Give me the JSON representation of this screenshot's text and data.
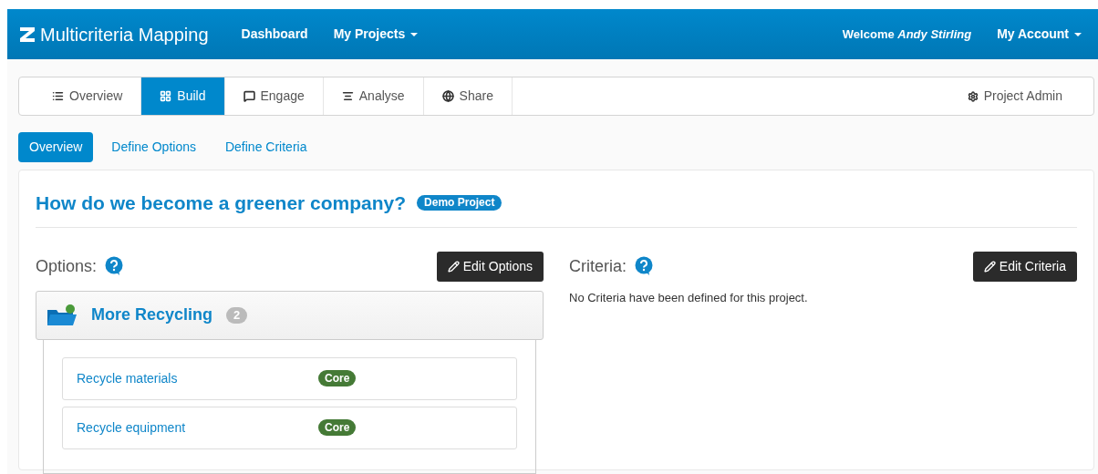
{
  "navbar": {
    "brand": "Multicriteria Mapping",
    "links": [
      {
        "label": "Dashboard",
        "dropdown": false
      },
      {
        "label": "My Projects",
        "dropdown": true
      }
    ],
    "welcome": "Welcome *Andy Stirling*",
    "account": {
      "label": "My Account",
      "dropdown": true
    }
  },
  "tabs": [
    {
      "label": "Overview",
      "selected": false
    },
    {
      "label": "Build",
      "selected": true
    },
    {
      "label": "Engage",
      "selected": false
    },
    {
      "label": "Analyse",
      "selected": false
    },
    {
      "label": "Share",
      "selected": false
    }
  ],
  "admin_link": "Project Admin",
  "subtabs": [
    {
      "label": "Overview",
      "selected": true
    },
    {
      "label": "Define Options",
      "selected": false
    },
    {
      "label": "Define Criteria",
      "selected": false
    }
  ],
  "project": {
    "title": "How do we become a greener company?",
    "badge": "Demo Project"
  },
  "options": {
    "heading": "Options:",
    "button": "Edit Options",
    "group": {
      "title": "More Recycling",
      "count": "2",
      "items": [
        {
          "name": "Recycle materials",
          "tag": "Core"
        },
        {
          "name": "Recycle equipment",
          "tag": "Core"
        }
      ]
    }
  },
  "criteria": {
    "heading": "Criteria:",
    "button": "Edit Criteria",
    "empty": "No Criteria have been defined for this project."
  }
}
